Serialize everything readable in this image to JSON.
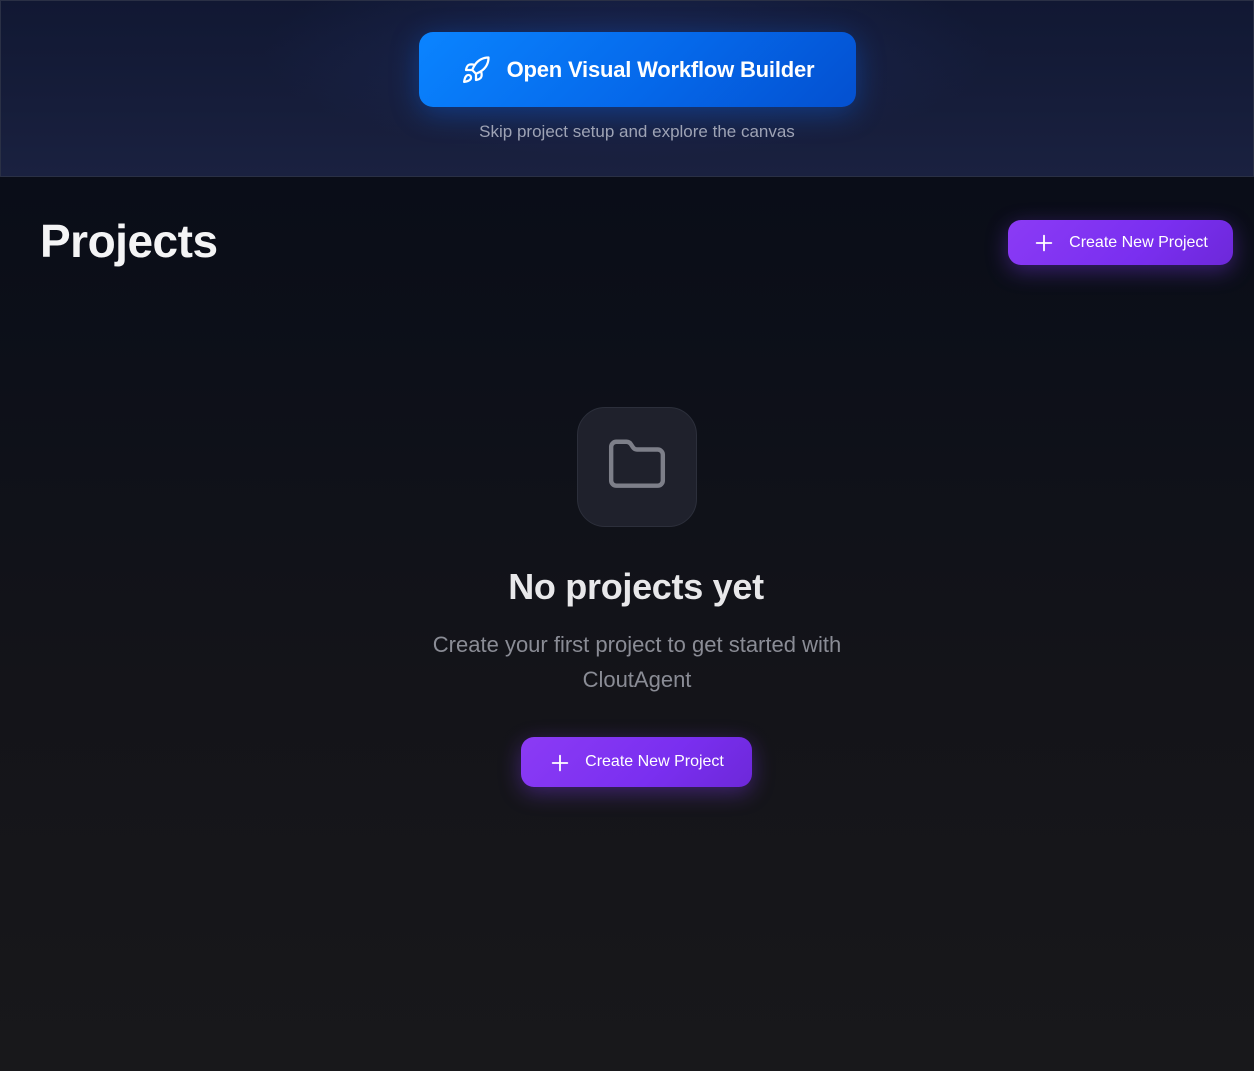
{
  "banner": {
    "button_label": "Open Visual Workflow Builder",
    "button_icon": "rocket-icon",
    "subtitle": "Skip project setup and explore the canvas"
  },
  "header": {
    "title": "Projects",
    "create_button_label": "Create New Project",
    "create_button_icon": "plus-icon"
  },
  "empty_state": {
    "icon": "folder-icon",
    "title": "No projects yet",
    "description": "Create your first project to get started with CloutAgent",
    "create_button_label": "Create New Project",
    "create_button_icon": "plus-icon"
  },
  "colors": {
    "workflow_button": "#0A84FF",
    "primary_button": "#7C3AED",
    "background": "#18181B",
    "banner_background": "#161D3A"
  }
}
